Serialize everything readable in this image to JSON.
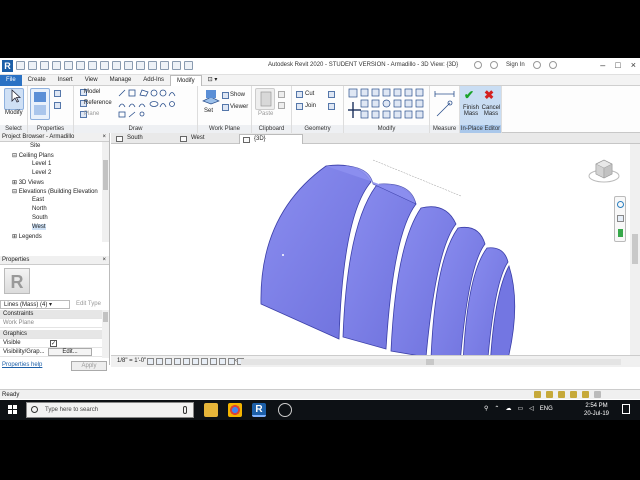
{
  "titlebar": {
    "app_logo": "R",
    "title": "Autodesk Revit 2020 - STUDENT VERSION - Armadillo - 3D View: {3D}",
    "sign_in": "Sign In"
  },
  "ribbon_tabs": [
    "File",
    "Create",
    "Insert",
    "View",
    "Manage",
    "Add-Ins",
    "Modify"
  ],
  "ribbon": {
    "modify_label": "Modify",
    "model_label": "Model",
    "reference_label": "Reference",
    "plane_label": "Plane",
    "show_label": "Show",
    "set_label": "Set",
    "viewer_label": "Viewer",
    "paste_label": "Paste",
    "cut_label": "Cut",
    "join_label": "Join",
    "finish_mass_label": "Finish Mass",
    "cancel_mass_label": "Cancel Mass",
    "panels": {
      "select": "Select",
      "properties": "Properties",
      "draw": "Draw",
      "work_plane": "Work Plane",
      "clipboard": "Clipboard",
      "geometry": "Geometry",
      "modify": "Modify",
      "measure": "Measure",
      "in_place_editor": "In-Place Editor"
    }
  },
  "project_browser": {
    "title": "Project Browser - Armadillo",
    "items": [
      "Site",
      "Ceiling Plans",
      "Level 1",
      "Level 2",
      "3D Views",
      "Elevations (Building Elevation",
      "East",
      "North",
      "South",
      "West",
      "Legends"
    ]
  },
  "properties": {
    "title": "Properties",
    "type_selector": "Lines (Mass) (4)",
    "edit_type": "Edit Type",
    "constraints_group": "Constraints",
    "work_plane_label": "Work Plane",
    "graphics_group": "Graphics",
    "visible_label": "Visible",
    "visibility_label": "Visibility/Grap...",
    "visibility_value": "Edit...",
    "help_link": "Properties help",
    "apply_button": "Apply"
  },
  "view_tabs": [
    "South",
    "West",
    "{3D}"
  ],
  "view_control": {
    "scale": "1/8\" = 1'-0\""
  },
  "status": {
    "text": "Ready"
  },
  "taskbar": {
    "search_placeholder": "Type here to search",
    "language": "ENG",
    "time": "2:54 PM",
    "date": "20-Jul-19"
  },
  "colors": {
    "mass_fill": "#7b7ee8",
    "mass_edge": "#3b3fa8",
    "file_tab": "#2b72c4",
    "finish_green": "#1aa32a",
    "cancel_red": "#d42020"
  }
}
